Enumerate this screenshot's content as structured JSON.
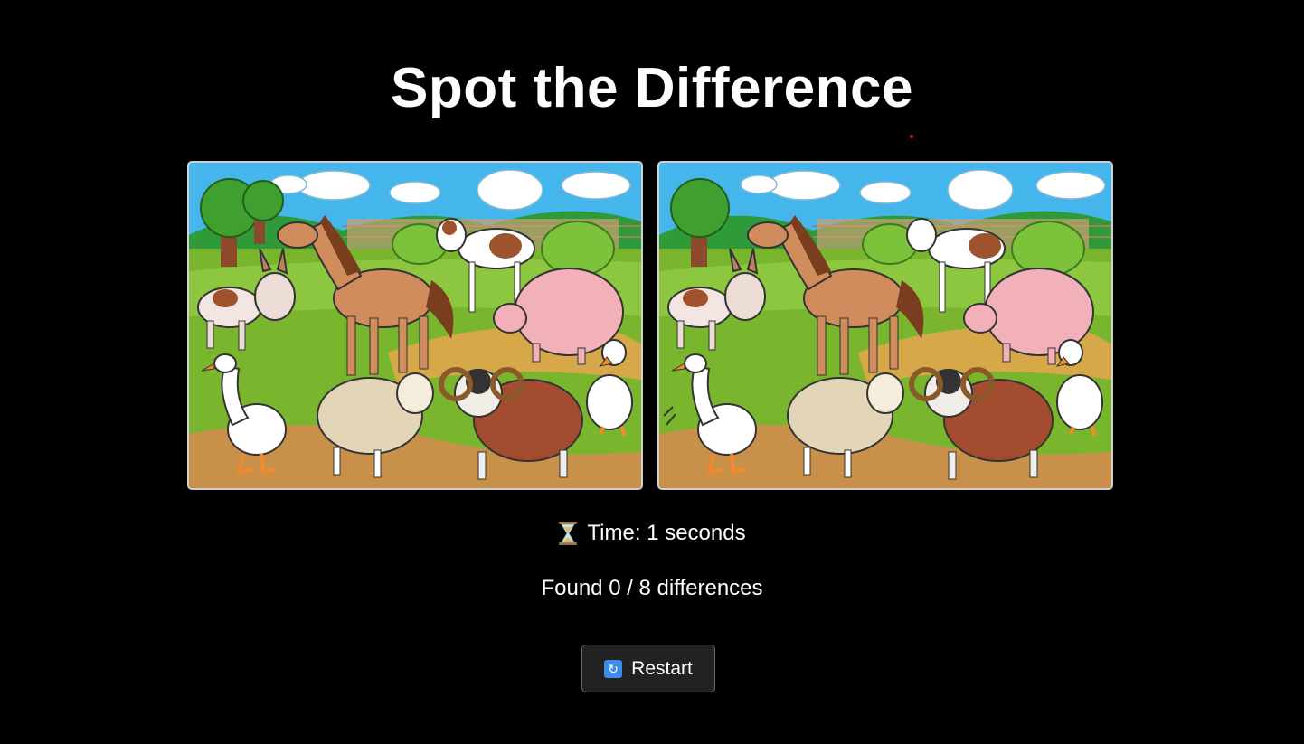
{
  "title": "Spot the Difference",
  "images": {
    "left_label": "Original farm scene",
    "right_label": "Modified farm scene"
  },
  "status": {
    "timer_icon": "hourglass-icon",
    "time_text": "Time: 1 seconds",
    "found_text": "Found 0 / 8 differences"
  },
  "controls": {
    "restart_icon": "restart-icon",
    "restart_label": "Restart"
  },
  "colors": {
    "background": "#000000",
    "text": "#ffffff",
    "button_bg": "#222222",
    "accent": "#3d8ee8"
  }
}
